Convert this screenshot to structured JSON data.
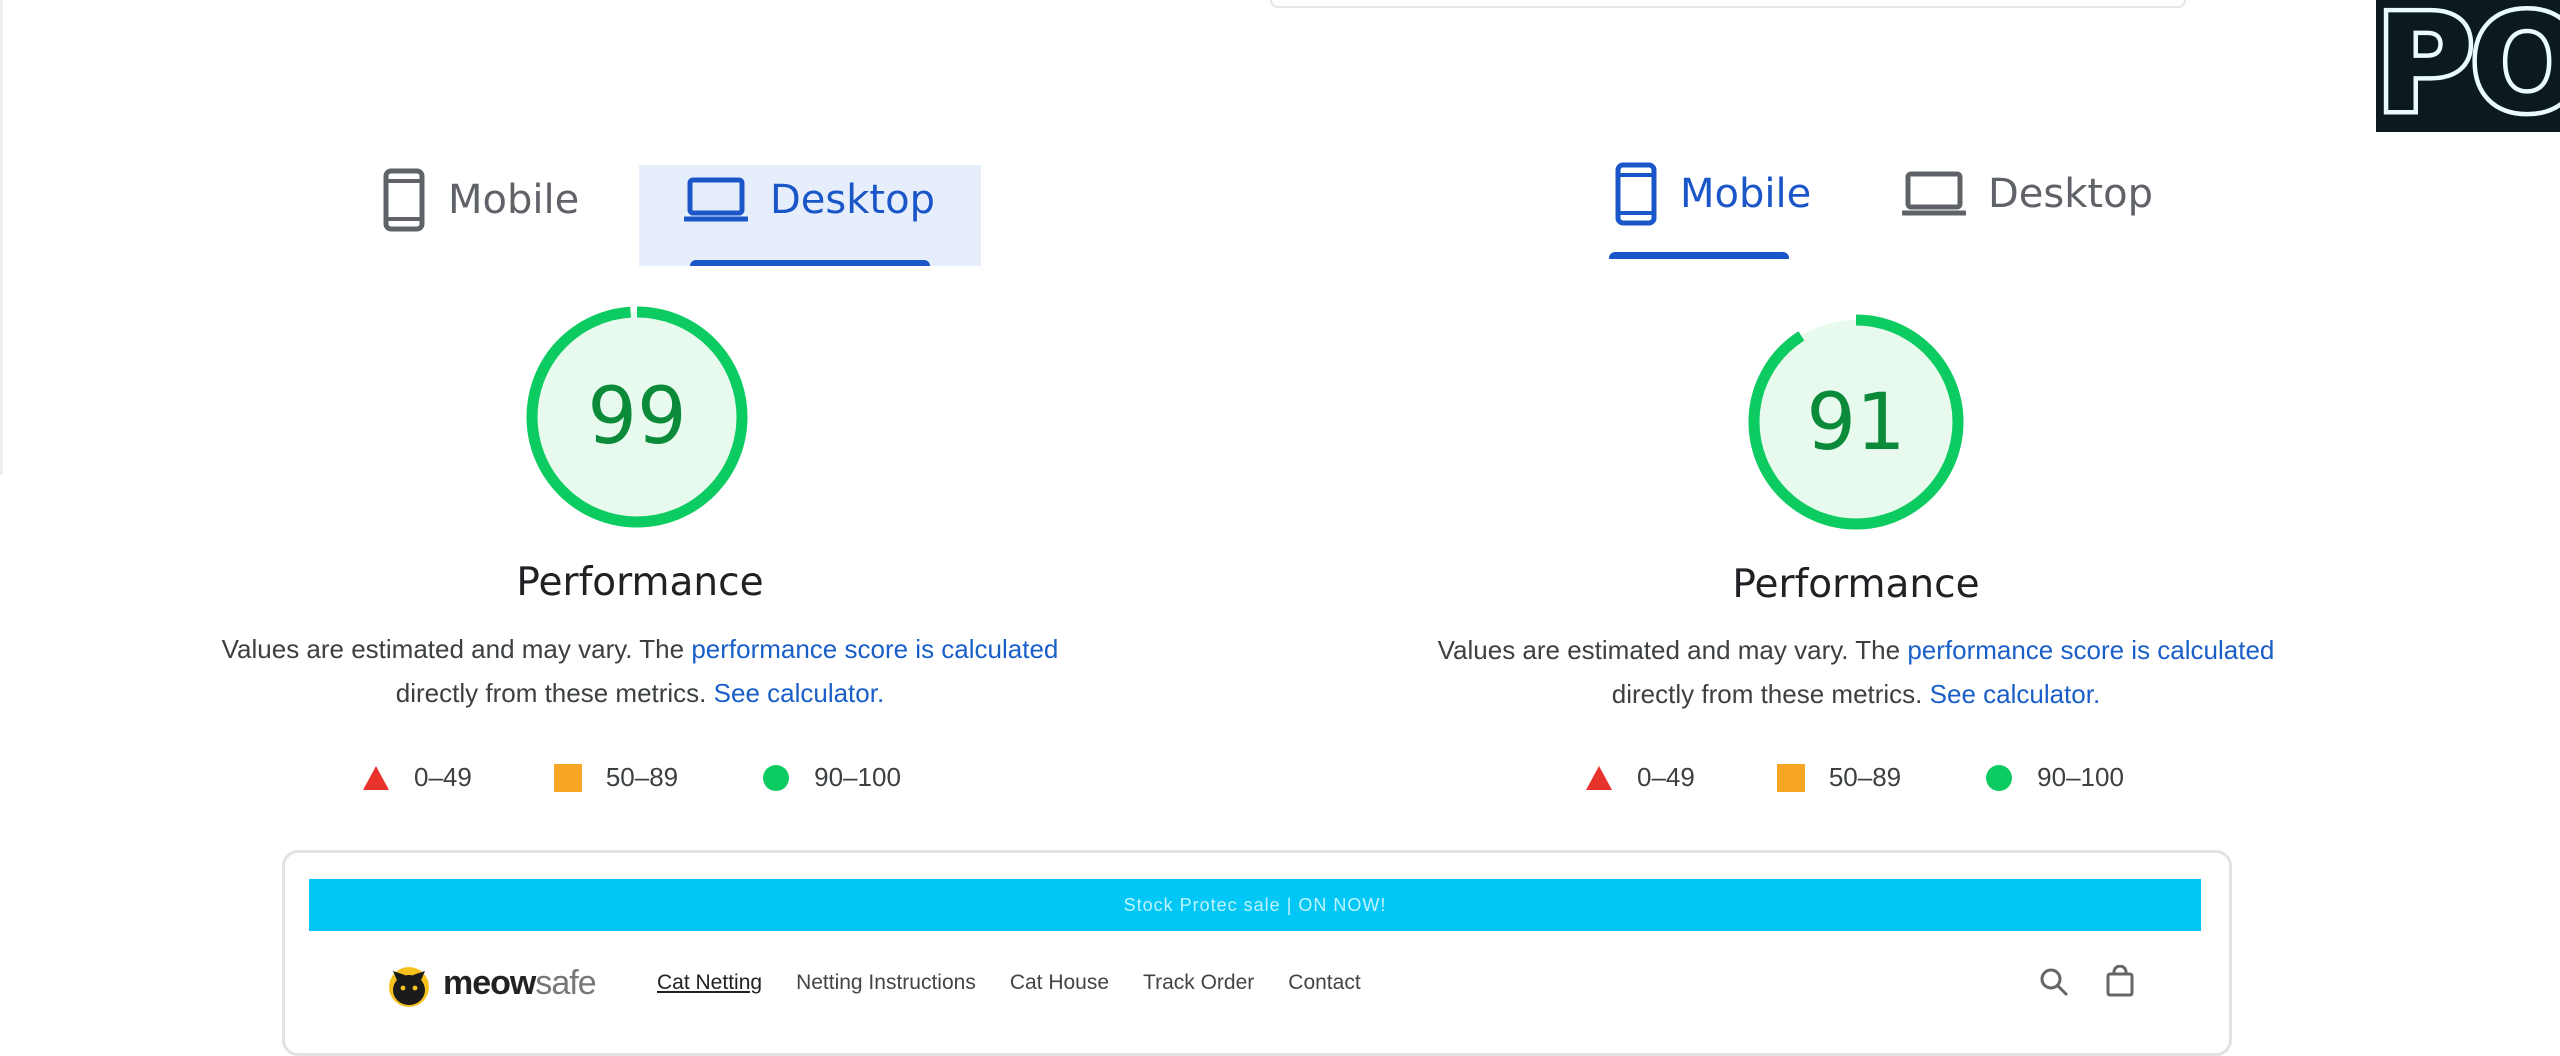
{
  "overlay": {
    "badge_text": "PO"
  },
  "panels": [
    {
      "id": "desktop-result",
      "tabs": [
        {
          "label": "Mobile",
          "icon": "phone-icon",
          "active": false
        },
        {
          "label": "Desktop",
          "icon": "laptop-icon",
          "active": true
        }
      ],
      "score": 99,
      "score_label": "Performance",
      "description": {
        "text_before": "Values are estimated and may vary. The ",
        "link1": "performance score is calculated",
        "text_middle": "directly from these metrics. ",
        "link2": "See calculator."
      },
      "legend": [
        {
          "label": "0–49",
          "shape": "triangle",
          "color": "#e8332c"
        },
        {
          "label": "50–89",
          "shape": "square",
          "color": "#f6a623"
        },
        {
          "label": "90–100",
          "shape": "circle",
          "color": "#0ccc61"
        }
      ]
    },
    {
      "id": "mobile-result",
      "tabs": [
        {
          "label": "Mobile",
          "icon": "phone-icon",
          "active": true
        },
        {
          "label": "Desktop",
          "icon": "laptop-icon",
          "active": false
        }
      ],
      "score": 91,
      "score_label": "Performance",
      "description": {
        "text_before": "Values are estimated and may vary. The ",
        "link1": "performance score is calculated",
        "text_middle": "directly from these metrics. ",
        "link2": "See calculator."
      },
      "legend": [
        {
          "label": "0–49",
          "shape": "triangle",
          "color": "#e8332c"
        },
        {
          "label": "50–89",
          "shape": "square",
          "color": "#f6a623"
        },
        {
          "label": "90–100",
          "shape": "circle",
          "color": "#0ccc61"
        }
      ]
    }
  ],
  "colors": {
    "gauge_ring": "#0ccc61",
    "gauge_fill": "#e8f9ee",
    "gauge_text": "#0b8a3a",
    "accent": "#1a56c8",
    "link": "#1a5fc8"
  },
  "preview": {
    "promo_text": "Stock Protec sale | ON NOW!",
    "logo_bold": "meow",
    "logo_light": "safe",
    "menu": [
      "Cat Netting",
      "Netting Instructions",
      "Cat House",
      "Track Order",
      "Contact"
    ]
  }
}
